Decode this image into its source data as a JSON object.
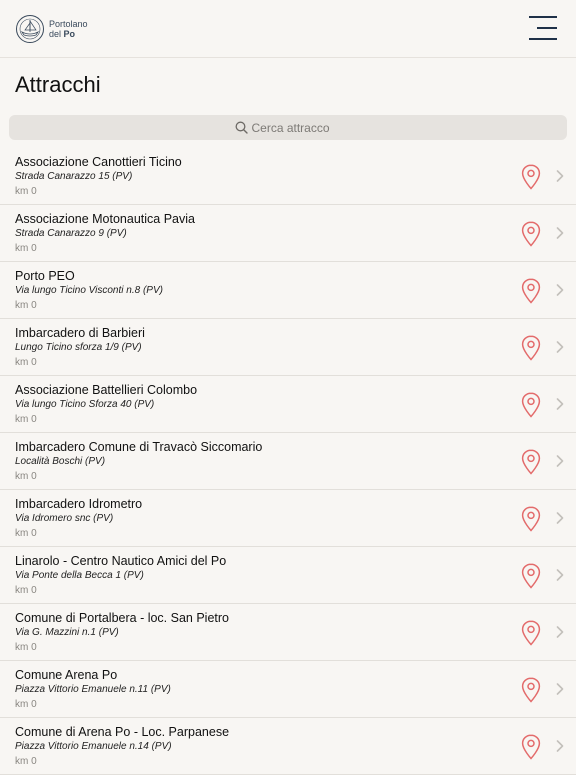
{
  "header": {
    "logo_line1": "Portolano",
    "logo_line2a": "del",
    "logo_line2b": "Po",
    "menu_icon": "hamburger-menu-icon"
  },
  "page": {
    "title": "Attracchi"
  },
  "search": {
    "placeholder": "Cerca attracco",
    "value": "",
    "icon": "magnifier-icon"
  },
  "colors": {
    "pin": "#e36b6b",
    "chevron": "#c3c0bb",
    "navy": "#1f3148"
  },
  "items": [
    {
      "name": "Associazione Canottieri Ticino",
      "address": "Strada Canarazzo 15 (PV)",
      "distance": "km 0"
    },
    {
      "name": "Associazione Motonautica Pavia",
      "address": "Strada Canarazzo 9 (PV)",
      "distance": "km 0"
    },
    {
      "name": "Porto PEO",
      "address": "Via lungo Ticino Visconti n.8 (PV)",
      "distance": "km 0"
    },
    {
      "name": "Imbarcadero di Barbieri",
      "address": "Lungo Ticino sforza 1/9 (PV)",
      "distance": "km 0"
    },
    {
      "name": "Associazione Battellieri Colombo",
      "address": "Via lungo Ticino Sforza 40 (PV)",
      "distance": "km 0"
    },
    {
      "name": "Imbarcadero Comune di Travacò Siccomario",
      "address": "Località Boschi (PV)",
      "distance": "km 0"
    },
    {
      "name": "Imbarcadero Idrometro",
      "address": "Via Idromero snc (PV)",
      "distance": "km 0"
    },
    {
      "name": "Linarolo - Centro Nautico Amici del Po",
      "address": "Via Ponte della Becca 1 (PV)",
      "distance": "km 0"
    },
    {
      "name": "Comune di Portalbera - loc. San Pietro",
      "address": "Via G. Mazzini n.1 (PV)",
      "distance": "km 0"
    },
    {
      "name": "Comune Arena Po",
      "address": "Piazza Vittorio Emanuele n.11 (PV)",
      "distance": "km 0"
    },
    {
      "name": "Comune di Arena Po - Loc. Parpanese",
      "address": "Piazza Vittorio Emanuele n.14 (PV)",
      "distance": "km 0"
    }
  ]
}
